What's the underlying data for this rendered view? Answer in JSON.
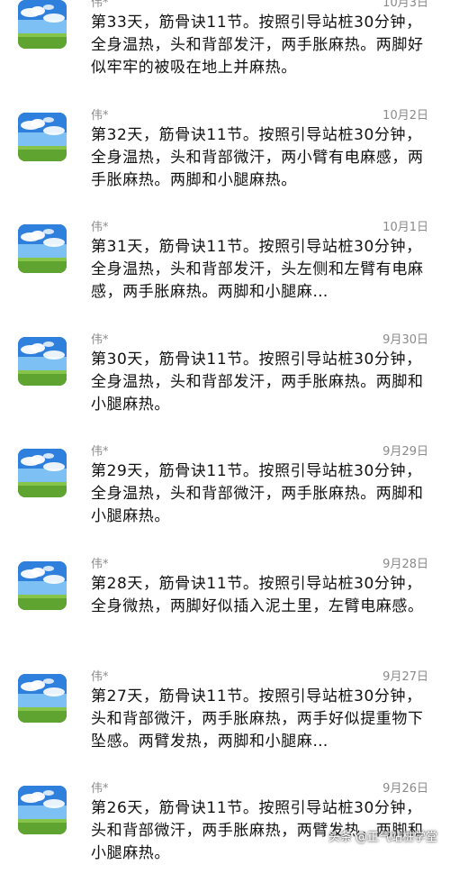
{
  "messages": [
    {
      "name": "伟*",
      "date": "10月3日",
      "text": "第33天，筋骨诀11节。按照引导站桩30分钟，全身温热，头和背部发汗，两手胀麻热。两脚好似牢牢的被吸在地上并麻热。"
    },
    {
      "name": "伟*",
      "date": "10月2日",
      "text": "第32天，筋骨诀11节。按照引导站桩30分钟，全身温热，头和背部微汗，两小臂有电麻感，两手胀麻热。两脚和小腿麻热。"
    },
    {
      "name": "伟*",
      "date": "10月1日",
      "text": "第31天，筋骨诀11节。按照引导站桩30分钟，全身温热，头和背部发汗，头左侧和左臂有电麻感，两手胀麻热。两脚和小腿麻…"
    },
    {
      "name": "伟*",
      "date": "9月30日",
      "text": "第30天，筋骨诀11节。按照引导站桩30分钟，全身温热，头和背部发汗，两手胀麻热。两脚和小腿麻热。"
    },
    {
      "name": "伟*",
      "date": "9月29日",
      "text": "第29天，筋骨诀11节。按照引导站桩30分钟，全身温热，头和背部微汗，两手胀麻热。两脚和小腿麻热。"
    },
    {
      "name": "伟*",
      "date": "9月28日",
      "text": "第28天，筋骨诀11节。按照引导站桩30分钟，全身微热，两脚好似插入泥土里，左臂电麻感。"
    },
    {
      "name": "伟*",
      "date": "9月27日",
      "text": "第27天，筋骨诀11节。按照引导站桩30分钟，头和背部微汗，两手胀麻热，两手好似提重物下坠感。两臂发热，两脚和小腿麻…"
    },
    {
      "name": "伟*",
      "date": "9月26日",
      "text": "第26天，筋骨诀11节。按照引导站桩30分钟，头和背部微汗，两手胀麻热，两臂发热，两脚和小腿麻热。"
    }
  ],
  "watermark": "头条 @正气站桩学堂",
  "avatar_icon": "sky-meadow-avatar"
}
